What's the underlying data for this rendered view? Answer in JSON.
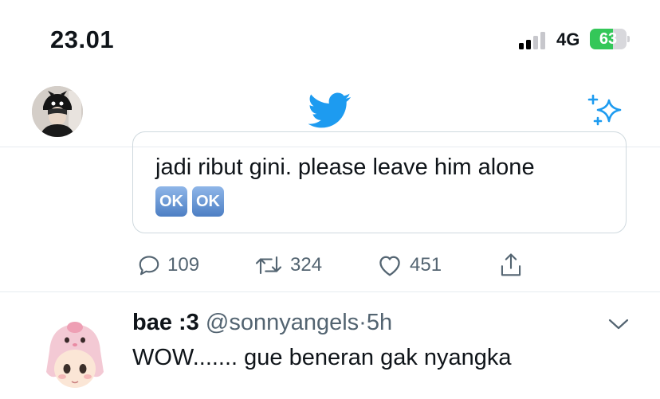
{
  "status_bar": {
    "time": "23.01",
    "network": "4G",
    "battery_level": 0.63,
    "battery_text": "63",
    "signal_bars_active": 2,
    "signal_bars_total": 4
  },
  "nav": {
    "profile_icon": "profile-avatar",
    "logo_icon": "twitter-bird-icon",
    "sparkle_icon": "sparkle-icon",
    "brand_color": "#1d9bf0"
  },
  "quoted_tweet": {
    "text": "jadi ribut gini. please leave him alone",
    "ok_badges": [
      "OK",
      "OK"
    ]
  },
  "actions": {
    "reply_count": "109",
    "retweet_count": "324",
    "like_count": "451"
  },
  "second_tweet": {
    "name": "bae :3",
    "handle": "@sonnyangels",
    "separator": "·",
    "time": "5h",
    "text": "WOW....... gue beneran gak nyangka"
  }
}
